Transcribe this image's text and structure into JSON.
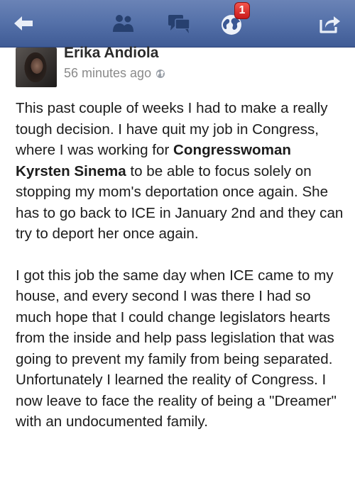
{
  "navbar": {
    "back_icon": "back-arrow-icon",
    "friends_icon": "friend-requests-icon",
    "messages_icon": "messages-icon",
    "notifications_icon": "globe-notifications-icon",
    "notifications_count": "1",
    "share_icon": "share-icon",
    "bar_color": "#5672aa"
  },
  "post": {
    "author": "Erika Andiola",
    "timestamp": "56 minutes ago",
    "privacy_icon": "public-globe-icon",
    "paragraph1": {
      "part1": "This past couple of weeks I had to make a really tough decision. I have quit my job in Congress, where I was working for ",
      "bold": "Congresswoman Kyrsten Sinema",
      "part2": " to be able to focus solely on stopping my mom's deportation once again. She has to go back to ICE in January 2nd and they can try to deport her once again."
    },
    "paragraph2": "I got this job the same day when ICE came to my house, and every second I was there I had so much hope that I could change legislators hearts from the inside and help pass legislation that was going to prevent my family from being separated. Unfortunately I learned the reality of Congress. I now leave to face the reality of being a \"Dreamer\" with an undocumented family."
  }
}
